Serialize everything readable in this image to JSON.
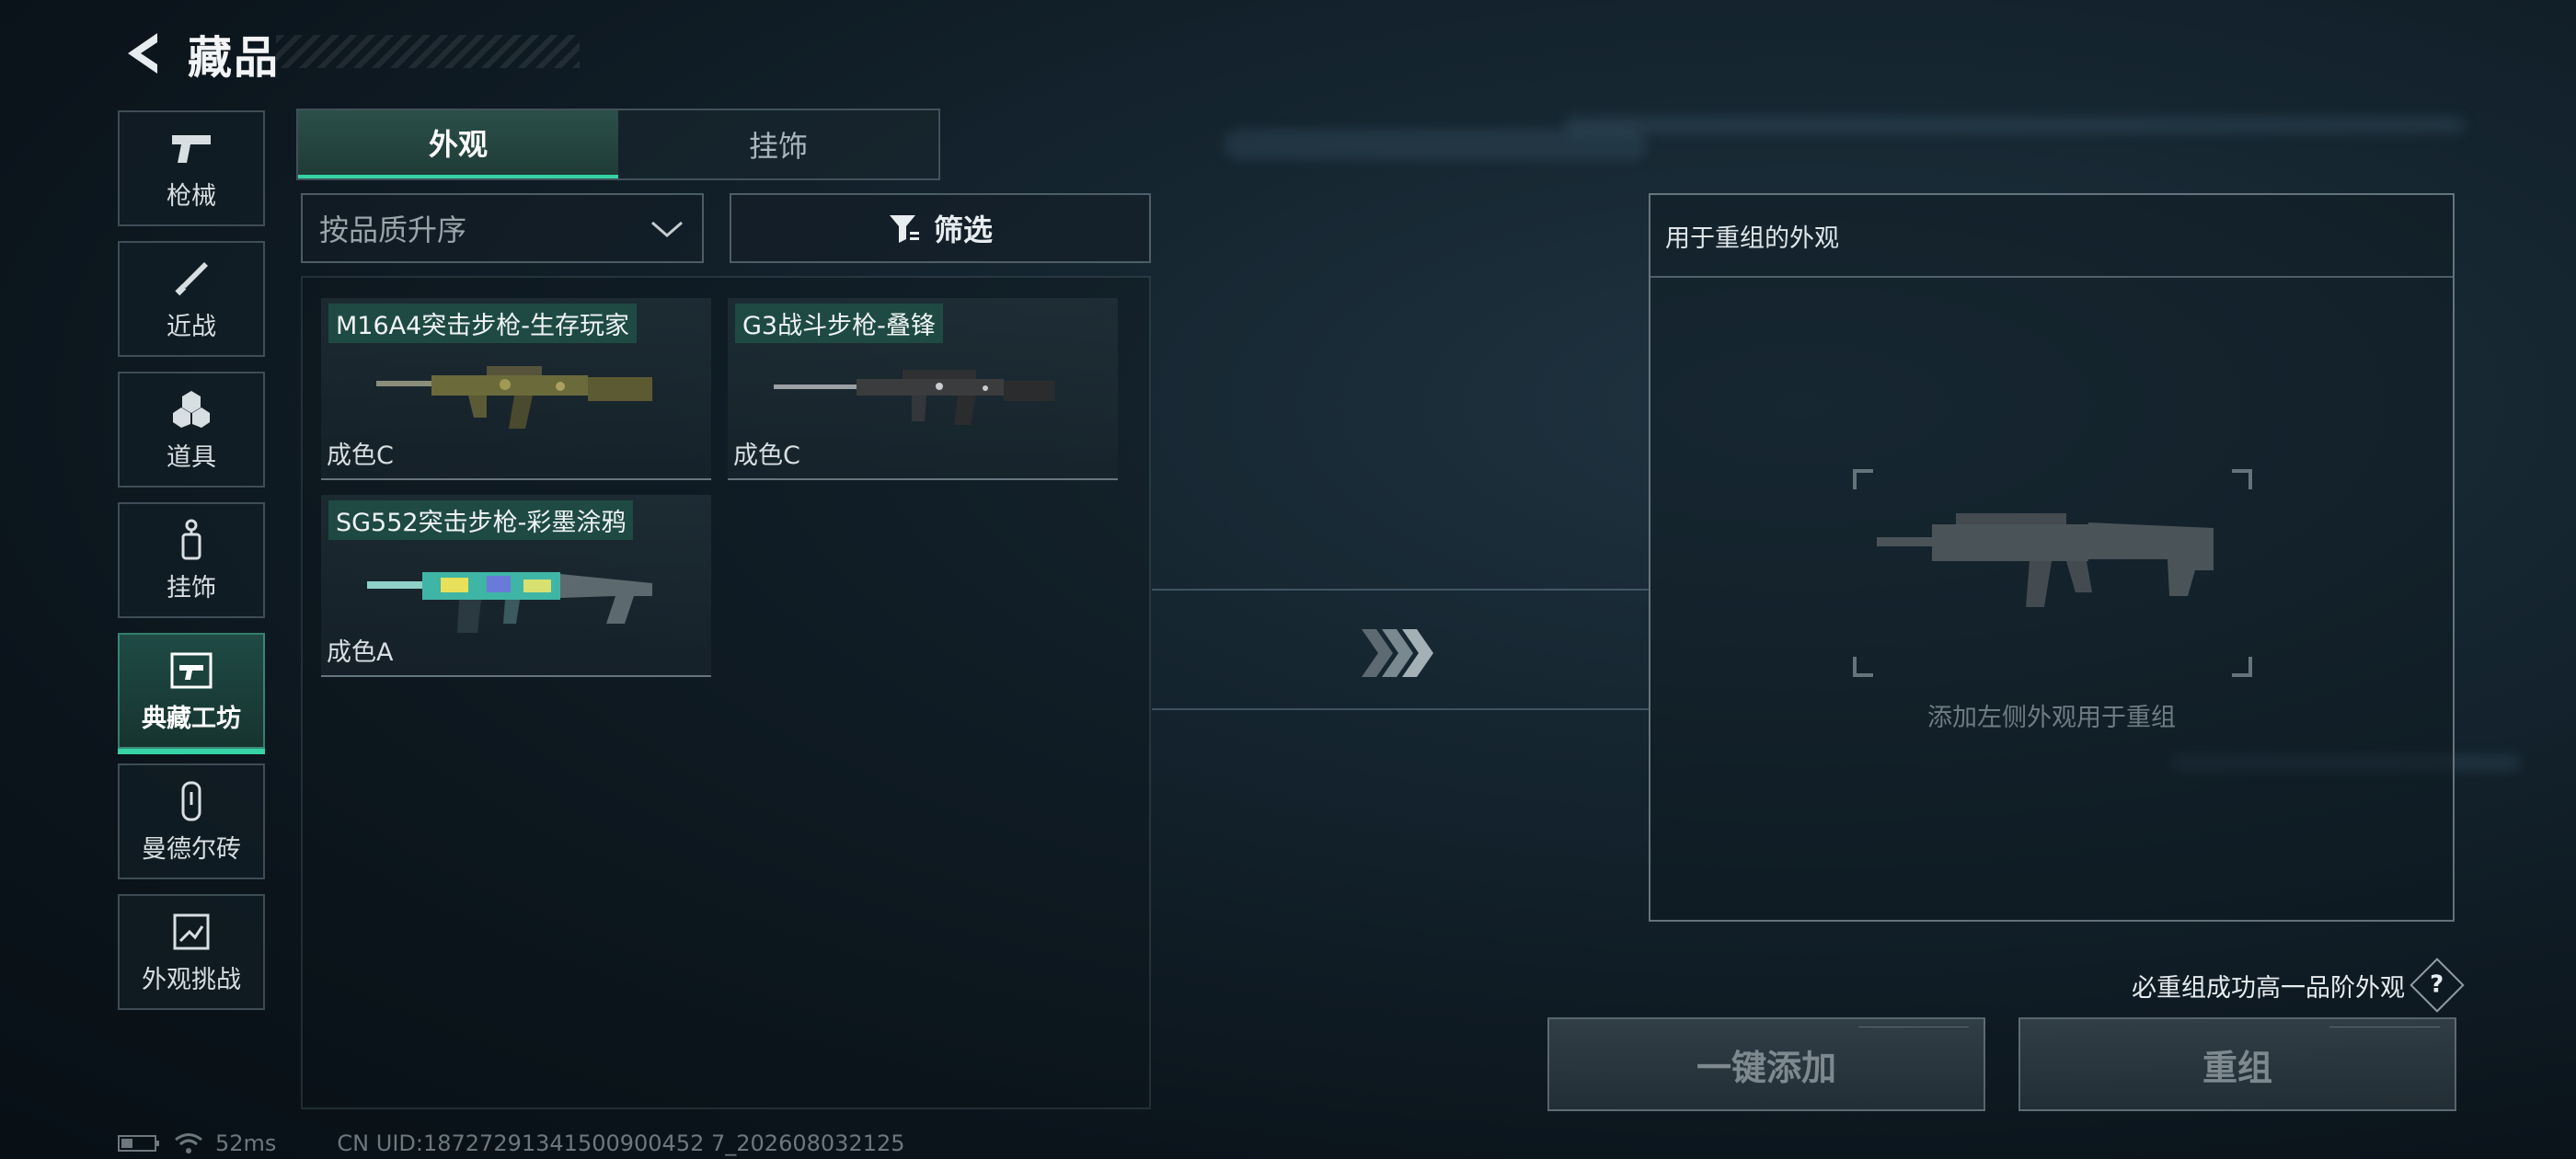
{
  "header": {
    "title": "藏品"
  },
  "nav": [
    {
      "label": "枪械",
      "icon": "pistol-icon"
    },
    {
      "label": "近战",
      "icon": "knife-icon"
    },
    {
      "label": "道具",
      "icon": "grenade-icon"
    },
    {
      "label": "挂饰",
      "icon": "charm-icon"
    },
    {
      "label": "典藏工坊",
      "icon": "workshop-icon",
      "active": true
    },
    {
      "label": "曼德尔砖",
      "icon": "brick-icon"
    },
    {
      "label": "外观挑战",
      "icon": "challenge-icon"
    }
  ],
  "tabs": [
    {
      "label": "外观",
      "active": true
    },
    {
      "label": "挂饰",
      "active": false
    }
  ],
  "sort": {
    "value": "按品质升序"
  },
  "filter": {
    "label": "筛选"
  },
  "skins": [
    {
      "name": "M16A4突击步枪-生存玩家",
      "grade": "成色C"
    },
    {
      "name": "G3战斗步枪-叠锋",
      "grade": "成色C"
    },
    {
      "name": "SG552突击步枪-彩墨涂鸦",
      "grade": "成色A"
    }
  ],
  "panel": {
    "title": "用于重组的外观",
    "hint": "添加左侧外观用于重组"
  },
  "guarantee": {
    "text": "必重组成功高一品阶外观",
    "help": "?"
  },
  "actions": {
    "add_all": "一键添加",
    "recombine": "重组"
  },
  "status": {
    "ping": "52ms",
    "uid": "CN UID:18727291341500900452 7_202608032125"
  }
}
